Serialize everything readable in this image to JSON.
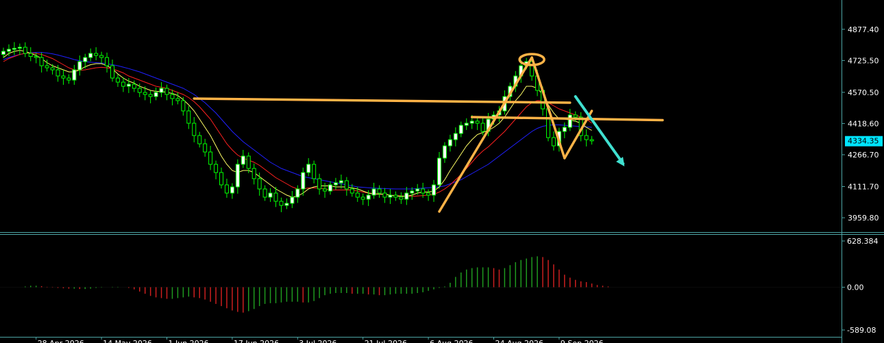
{
  "colors": {
    "background": "#000000",
    "axis": "#4da6a6",
    "bull_candle": "#00ff00",
    "bear_candle": "#ffffff",
    "ma_fast": "#ffff66",
    "ma_mid": "#ff2020",
    "ma_slow": "#2020ff",
    "annotation": "#ffb347",
    "arrow": "#40e0d0",
    "osc_up": "#1f9a1f",
    "osc_down": "#cc1f1f",
    "price_tag": "#00e5ff"
  },
  "chart_data": [
    {
      "type": "candlestick",
      "y_ticks": [
        "4877.40",
        "4725.50",
        "4570.50",
        "4418.60",
        "4266.70",
        "4111.70",
        "3959.80"
      ],
      "ylim": [
        3920,
        4960
      ],
      "current_price": "4334.35",
      "x_tick_labels": [
        "28 Apr 2026",
        "14 May 2026",
        "1 Jun 2026",
        "17 Jun 2026",
        "3 Jul 2026",
        "21 Jul 2026",
        "6 Aug 2026",
        "24 Aug 2026",
        "9 Sep 2026"
      ],
      "x_tick_labels_at_bar": [
        6,
        18,
        30,
        42,
        54,
        66,
        78,
        90,
        102
      ],
      "closes": [
        4770,
        4780,
        4785,
        4790,
        4760,
        4745,
        4740,
        4700,
        4690,
        4680,
        4650,
        4640,
        4630,
        4680,
        4720,
        4740,
        4760,
        4750,
        4740,
        4700,
        4640,
        4620,
        4600,
        4610,
        4590,
        4570,
        4560,
        4550,
        4570,
        4590,
        4560,
        4540,
        4530,
        4480,
        4420,
        4360,
        4320,
        4280,
        4220,
        4180,
        4120,
        4080,
        4110,
        4220,
        4260,
        4200,
        4150,
        4100,
        4060,
        4080,
        4040,
        4020,
        4030,
        4060,
        4100,
        4180,
        4220,
        4150,
        4100,
        4090,
        4120,
        4130,
        4140,
        4100,
        4080,
        4060,
        4050,
        4070,
        4100,
        4080,
        4060,
        4070,
        4060,
        4050,
        4080,
        4090,
        4100,
        4080,
        4070,
        4120,
        4250,
        4310,
        4340,
        4370,
        4410,
        4420,
        4430,
        4420,
        4380,
        4440,
        4460,
        4480,
        4550,
        4600,
        4650,
        4700,
        4720,
        4650,
        4580,
        4490,
        4350,
        4310,
        4380,
        4400,
        4460,
        4450,
        4360,
        4340,
        4334
      ],
      "ma_fast": [
        4740,
        4760,
        4770,
        4775,
        4770,
        4760,
        4750,
        4735,
        4715,
        4700,
        4690,
        4680,
        4670,
        4670,
        4680,
        4695,
        4705,
        4710,
        4710,
        4700,
        4685,
        4660,
        4640,
        4625,
        4615,
        4600,
        4590,
        4580,
        4575,
        4575,
        4570,
        4565,
        4555,
        4535,
        4510,
        4480,
        4440,
        4400,
        4360,
        4310,
        4260,
        4220,
        4190,
        4180,
        4190,
        4190,
        4180,
        4160,
        4140,
        4120,
        4100,
        4085,
        4070,
        4060,
        4065,
        4080,
        4100,
        4110,
        4115,
        4115,
        4115,
        4110,
        4110,
        4110,
        4105,
        4100,
        4090,
        4080,
        4075,
        4075,
        4075,
        4070,
        4065,
        4065,
        4065,
        4070,
        4080,
        4085,
        4085,
        4090,
        4110,
        4145,
        4190,
        4230,
        4270,
        4310,
        4340,
        4365,
        4375,
        4385,
        4400,
        4420,
        4450,
        4490,
        4530,
        4560,
        4600,
        4600,
        4590,
        4560,
        4510,
        4470,
        4440,
        4440,
        4435,
        4430,
        4420,
        4400,
        4385
      ],
      "ma_mid": [
        4720,
        4735,
        4745,
        4755,
        4760,
        4762,
        4760,
        4755,
        4745,
        4735,
        4720,
        4705,
        4690,
        4680,
        4678,
        4680,
        4685,
        4690,
        4692,
        4690,
        4685,
        4675,
        4665,
        4650,
        4640,
        4630,
        4620,
        4610,
        4600,
        4595,
        4590,
        4580,
        4570,
        4560,
        4545,
        4525,
        4500,
        4470,
        4440,
        4400,
        4360,
        4320,
        4290,
        4265,
        4250,
        4240,
        4230,
        4215,
        4195,
        4175,
        4155,
        4140,
        4125,
        4110,
        4100,
        4100,
        4105,
        4105,
        4105,
        4100,
        4095,
        4095,
        4095,
        4095,
        4095,
        4090,
        4085,
        4080,
        4078,
        4075,
        4073,
        4070,
        4068,
        4066,
        4064,
        4064,
        4066,
        4068,
        4070,
        4074,
        4085,
        4100,
        4120,
        4145,
        4170,
        4200,
        4230,
        4260,
        4285,
        4305,
        4330,
        4355,
        4380,
        4410,
        4440,
        4470,
        4500,
        4520,
        4530,
        4530,
        4520,
        4505,
        4490,
        4480,
        4470,
        4460,
        4450,
        4440,
        4420
      ],
      "ma_slow": [
        4730,
        4740,
        4748,
        4755,
        4760,
        4763,
        4765,
        4765,
        4762,
        4758,
        4752,
        4745,
        4738,
        4730,
        4724,
        4720,
        4717,
        4715,
        4713,
        4710,
        4705,
        4700,
        4693,
        4686,
        4678,
        4670,
        4660,
        4650,
        4640,
        4630,
        4620,
        4610,
        4600,
        4590,
        4575,
        4560,
        4540,
        4520,
        4495,
        4470,
        4440,
        4410,
        4380,
        4355,
        4330,
        4310,
        4290,
        4270,
        4250,
        4230,
        4215,
        4200,
        4190,
        4180,
        4170,
        4160,
        4155,
        4150,
        4145,
        4140,
        4135,
        4130,
        4125,
        4120,
        4115,
        4110,
        4108,
        4106,
        4104,
        4103,
        4102,
        4101,
        4100,
        4100,
        4100,
        4100,
        4102,
        4104,
        4106,
        4108,
        4110,
        4115,
        4125,
        4135,
        4145,
        4160,
        4175,
        4190,
        4205,
        4220,
        4240,
        4260,
        4280,
        4300,
        4320,
        4340,
        4360,
        4380,
        4395,
        4405,
        4410,
        4412,
        4412,
        4410,
        4408,
        4406,
        4404,
        4402,
        4400
      ]
    },
    {
      "type": "bar",
      "y_ticks": [
        "628.384",
        "0.00",
        "-589.08"
      ],
      "ylim": [
        -589.08,
        628.384
      ],
      "values": [
        0,
        10,
        20,
        20,
        15,
        5,
        -5,
        -10,
        -15,
        -20,
        -20,
        -25,
        -25,
        -20,
        -10,
        -5,
        0,
        5,
        5,
        0,
        -10,
        -30,
        -60,
        -90,
        -120,
        -140,
        -150,
        -160,
        -160,
        -150,
        -140,
        -130,
        -140,
        -150,
        -170,
        -200,
        -230,
        -260,
        -290,
        -320,
        -340,
        -350,
        -330,
        -300,
        -260,
        -230,
        -220,
        -220,
        -210,
        -200,
        -200,
        -200,
        -210,
        -210,
        -190,
        -150,
        -110,
        -90,
        -80,
        -80,
        -80,
        -90,
        -90,
        -90,
        -100,
        -100,
        -110,
        -110,
        -100,
        -90,
        -90,
        -90,
        -90,
        -80,
        -70,
        -50,
        -30,
        -10,
        10,
        60,
        140,
        200,
        240,
        260,
        270,
        270,
        270,
        260,
        240,
        260,
        300,
        340,
        370,
        390,
        410,
        420,
        410,
        370,
        310,
        240,
        170,
        130,
        100,
        80,
        70,
        50,
        30,
        20,
        10
      ]
    }
  ],
  "annotations": {
    "ellipse": {
      "bar": 97,
      "price": 4730
    },
    "lines": [
      {
        "from": {
          "bar": 35,
          "price": 4540
        },
        "to": {
          "bar": 104,
          "price": 4520
        }
      },
      {
        "from": {
          "bar": 86,
          "price": 4450
        },
        "to": {
          "bar": 121,
          "price": 4435
        }
      },
      {
        "from": {
          "bar": 80,
          "price": 3990
        },
        "to": {
          "bar": 97,
          "price": 4740
        }
      },
      {
        "from": {
          "bar": 97,
          "price": 4740
        },
        "to": {
          "bar": 103,
          "price": 4250
        }
      },
      {
        "from": {
          "bar": 103,
          "price": 4250
        },
        "to": {
          "bar": 108,
          "price": 4480
        }
      }
    ],
    "arrow": {
      "from": {
        "bar": 105,
        "price": 4550
      },
      "to": {
        "bar": 114,
        "price": 4210
      }
    }
  }
}
